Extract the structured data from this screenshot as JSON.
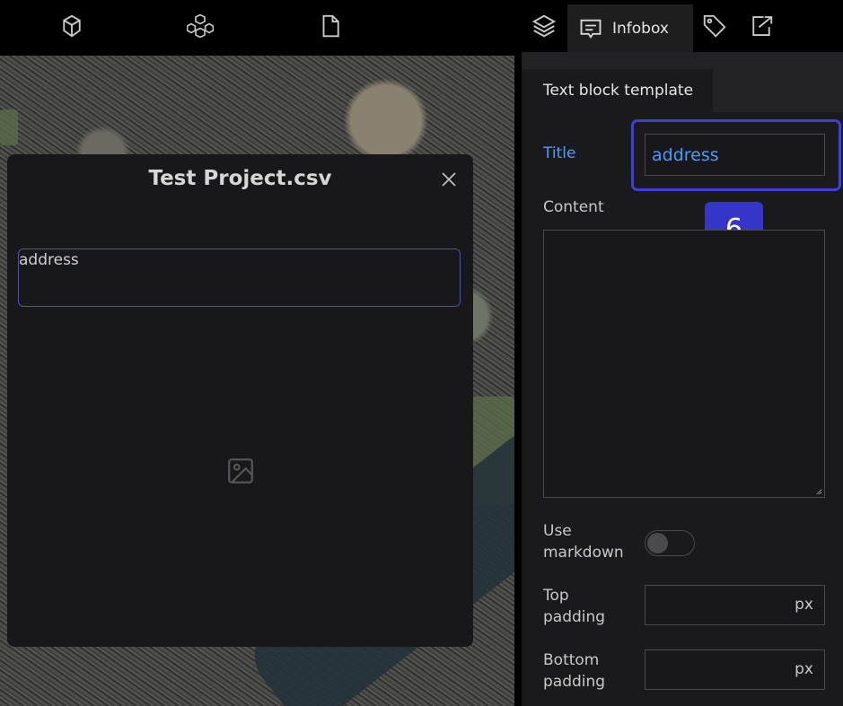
{
  "toolbar": {
    "icons": [
      "cube-outline-icon",
      "cubes-icon",
      "file-icon",
      "layers-icon",
      "infobox-icon",
      "tag-icon",
      "export-icon"
    ],
    "active_tab_label": "Infobox"
  },
  "dialog": {
    "title": "Test Project.csv",
    "text_block_value": "address"
  },
  "panel": {
    "section_tab": "Text block template",
    "title_label": "Title",
    "title_value": "address",
    "step_badge": "6",
    "content_label": "Content",
    "use_markdown_label_1": "Use",
    "use_markdown_label_2": "markdown",
    "top_padding_label_1": "Top",
    "top_padding_label_2": "padding",
    "bottom_padding_label_1": "Bottom",
    "bottom_padding_label_2": "padding",
    "unit": "px"
  },
  "colors": {
    "accent_blue": "#4b9cff",
    "focus_ring": "#3d3de0",
    "badge": "#3535c8"
  }
}
